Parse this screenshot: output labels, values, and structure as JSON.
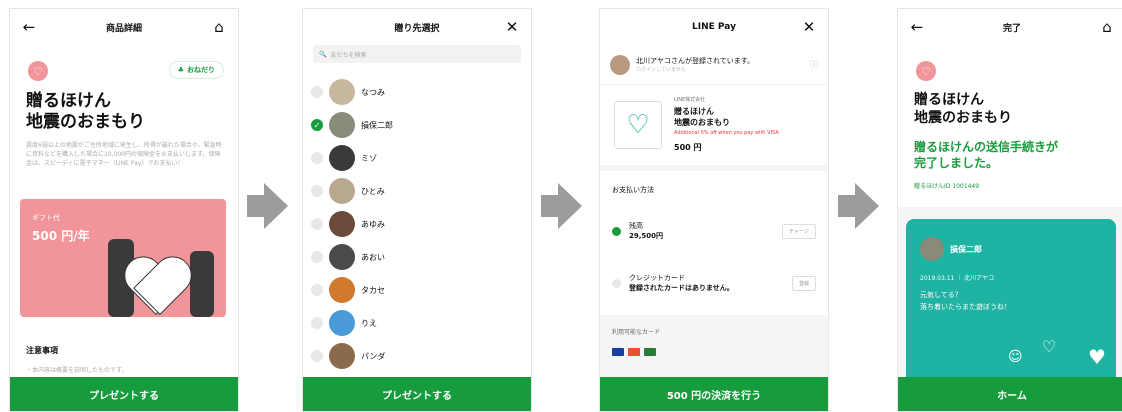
{
  "screen1": {
    "header_title": "商品詳細",
    "pill_label": "おねだり",
    "title_line1": "贈るほけん",
    "title_line2": "地震のおまもり",
    "description": "震度6弱以上の地震がご住所地域に発生し、所得が最れた場合や、緊急時に資料などを購入した場合に10,000円の保険金をお支払いします。保険金は、スピーディに電子マネー（LINE Pay）でお支払い！",
    "gift_label": "ギフト代",
    "gift_amount": "500 円/年",
    "notes_title": "注意事項",
    "notes_sub": "・本内容は概要を説明したものです。",
    "cta": "プレゼントする"
  },
  "screen2": {
    "header_title": "贈り先選択",
    "search_placeholder": "友だちを検索",
    "friends": [
      {
        "name": "なつみ",
        "selected": false,
        "color": "#c9b8a0"
      },
      {
        "name": "損保二郎",
        "selected": true,
        "color": "#8a8a7a"
      },
      {
        "name": "ミゾ",
        "selected": false,
        "color": "#3a3a3a"
      },
      {
        "name": "ひとみ",
        "selected": false,
        "color": "#b8a890"
      },
      {
        "name": "あゆみ",
        "selected": false,
        "color": "#6b4b3b"
      },
      {
        "name": "あおい",
        "selected": false,
        "color": "#4a4a4a"
      },
      {
        "name": "タカセ",
        "selected": false,
        "color": "#d07a30"
      },
      {
        "name": "りえ",
        "selected": false,
        "color": "#4a9ad8"
      },
      {
        "name": "パンダ",
        "selected": false,
        "color": "#8a6a4a"
      }
    ],
    "cta": "プレゼントする"
  },
  "screen3": {
    "header_title": "LINE Pay",
    "login_text": "北川アヤコさんが登録されています。",
    "login_sub": "ログインしていません",
    "merchant": "LINE株式会社",
    "product_line1": "贈るほけん",
    "product_line2": "地震のおまもり",
    "promo": "Additional 5% off when you pay with VISA",
    "price": "500 円",
    "payment_method_label": "お支払い方法",
    "balance_label": "残高",
    "balance_amount": "29,500円",
    "charge_button": "チャージ",
    "credit_label": "クレジットカード",
    "credit_sub": "登録されたカードはありません。",
    "register_button": "登録",
    "available_cards_label": "利用可能なカード",
    "cta": "500 円の決済を行う"
  },
  "screen4": {
    "header_title": "完了",
    "title_line1": "贈るほけん",
    "title_line2": "地震のおまもり",
    "done_line1": "贈るほけんの送信手続きが",
    "done_line2": "完了しました。",
    "id_text": "贈るほけんID 1001449",
    "recipient": "損保二郎",
    "meta": "2019.03.11 ｜ 北川アヤコ",
    "message_line1": "元気してる？",
    "message_line2": "落ち着いたらまた遊ぼうね！",
    "cta": "ホーム"
  },
  "colors": {
    "brand_green": "#179c3d",
    "gift_pink": "#f2959a",
    "card_teal": "#1fb3a3"
  }
}
